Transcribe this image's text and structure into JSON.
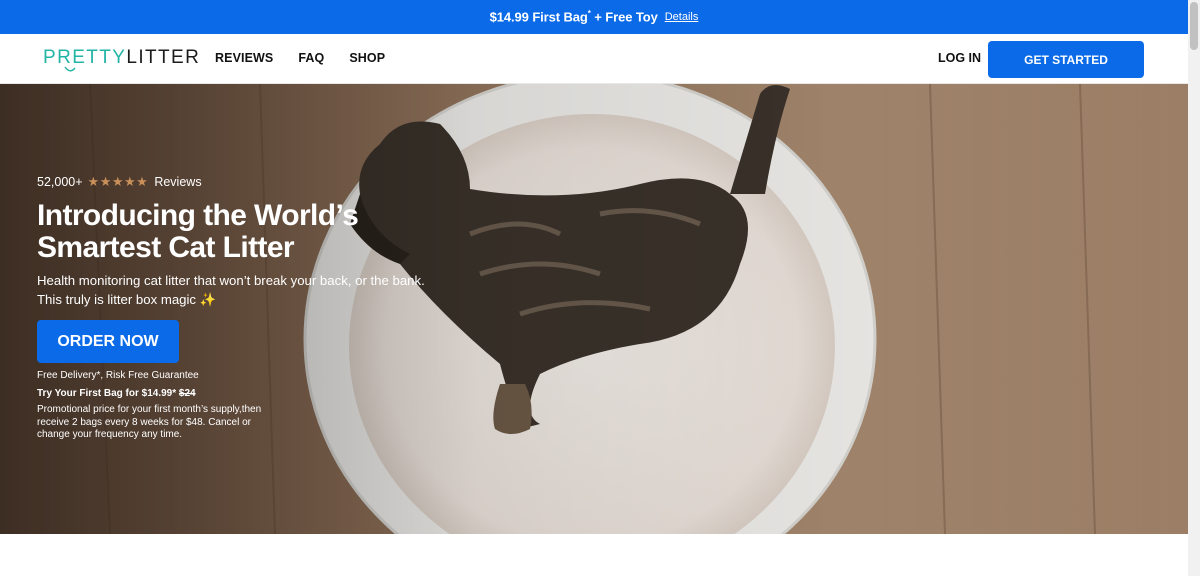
{
  "promo": {
    "text": "$14.99 First Bag",
    "sup": "*",
    "text_suffix": " + Free Toy",
    "details_label": "Details"
  },
  "header": {
    "logo_part1": "PRETTY",
    "logo_part2": "LITTER",
    "nav": [
      "REVIEWS",
      "FAQ",
      "SHOP"
    ],
    "login_label": "LOG IN",
    "cta_label": "GET STARTED"
  },
  "hero": {
    "review_count": "52,000+",
    "stars": "★★★★★",
    "reviews_label": "Reviews",
    "headline": "Introducing the World’s Smartest Cat Litter",
    "subline1": "Health monitoring cat litter that won’t break your back, or the bank.",
    "subline2": "This truly is litter box magic",
    "sparkle": "✨",
    "order_label": "ORDER NOW",
    "delivery": "Free Delivery*, Risk Free Guarantee",
    "price_prefix": "Try Your First Bag for $14.99*",
    "price_old": "$24",
    "fine_print": "Promotional price for your first month’s supply,then receive 2 bags every 8 weeks for $48. Cancel or change your frequency any time."
  },
  "colors": {
    "brand_blue": "#0a6ae8",
    "logo_teal": "#23b4a6",
    "star": "#c9905a"
  }
}
